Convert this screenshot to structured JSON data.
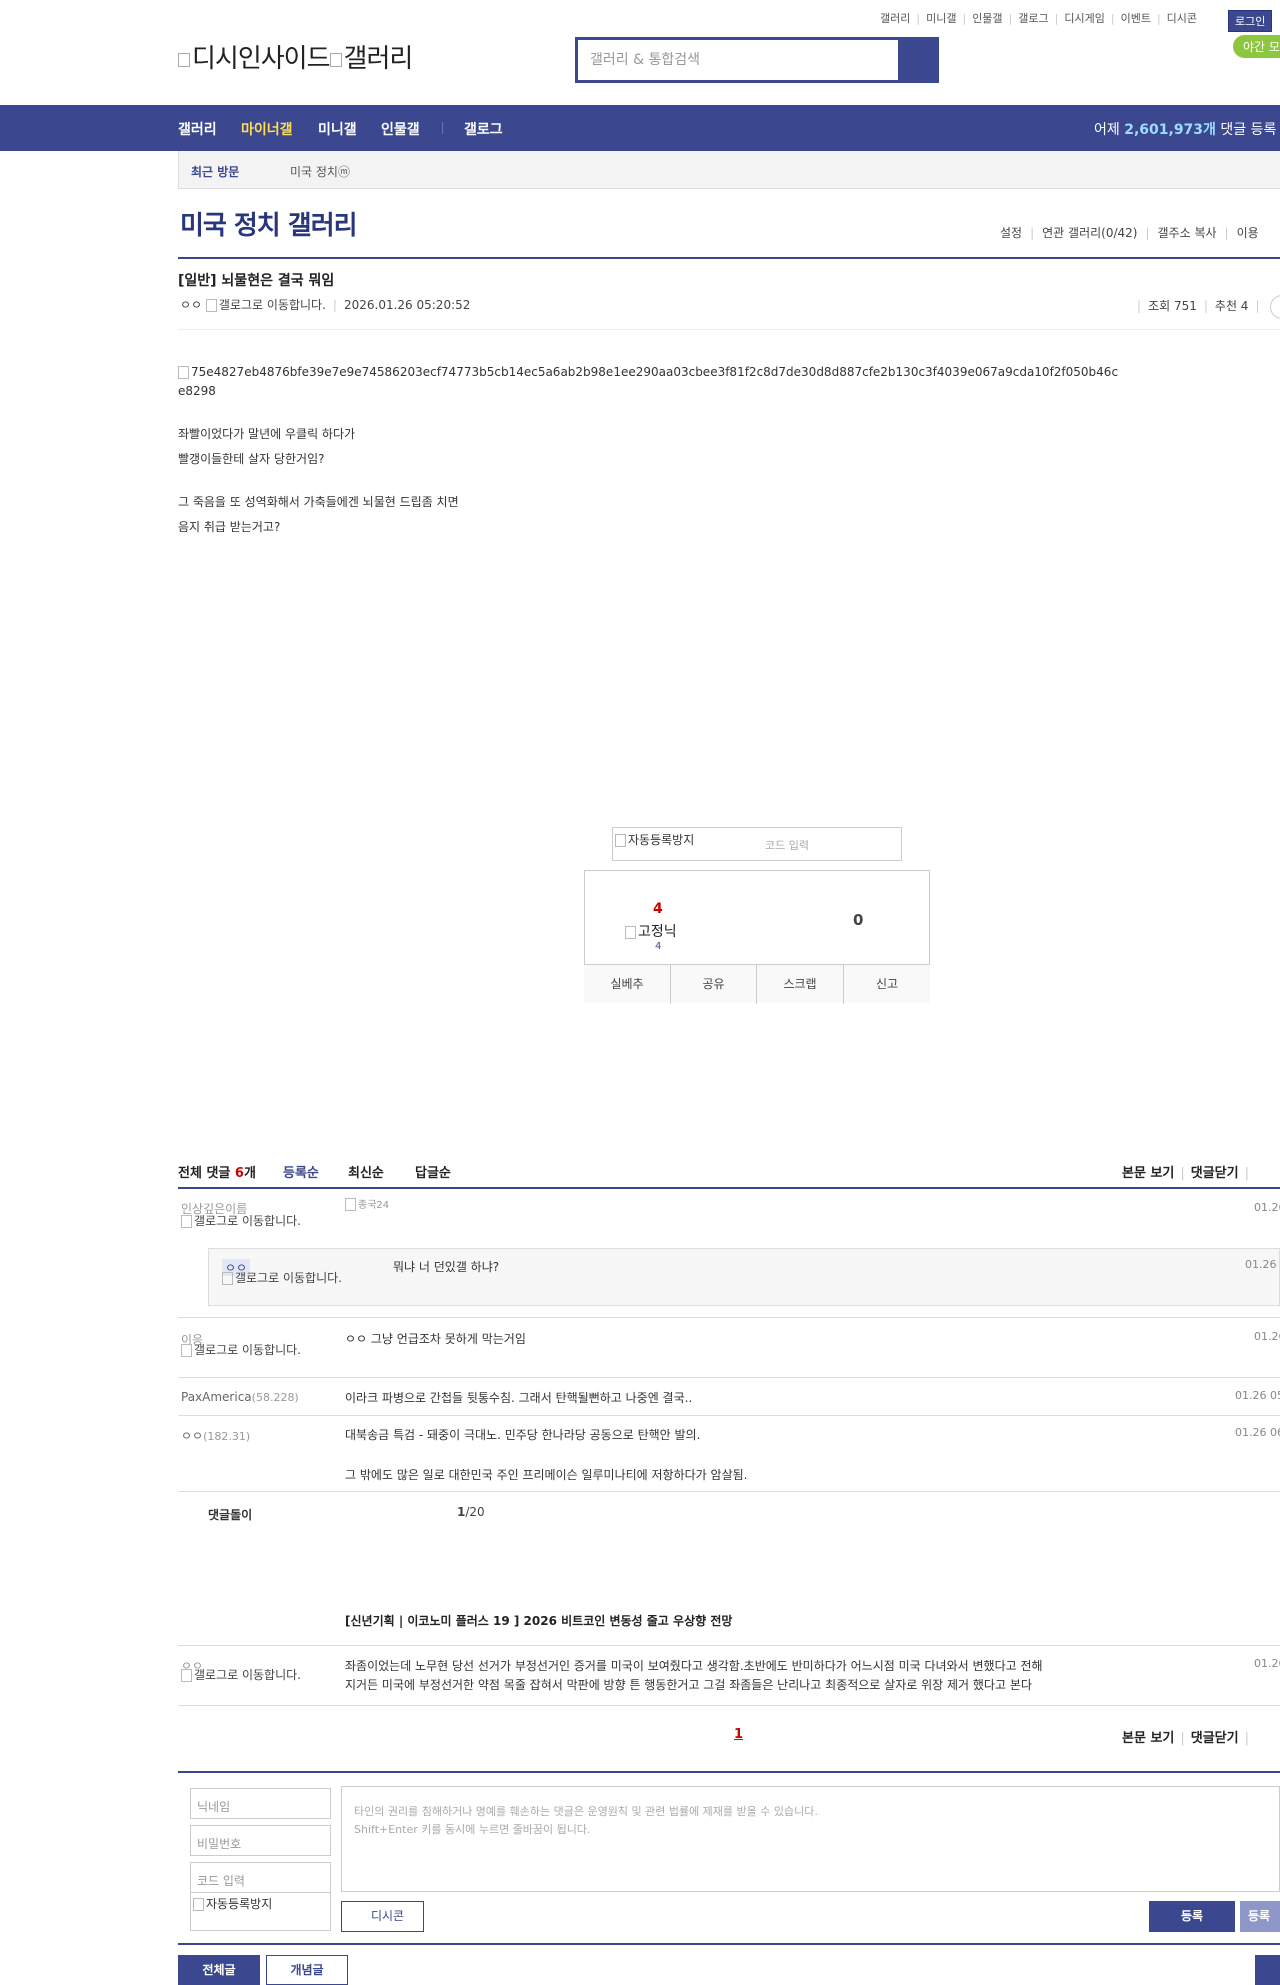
{
  "top_nav": {
    "links": [
      "갤러리",
      "미니갤",
      "인물갤",
      "갤로그",
      "디시게임",
      "이벤트",
      "디시콘"
    ],
    "login": "로그인",
    "night_mode": "야간 모"
  },
  "logo": {
    "alt1": "디시인사이드",
    "alt2": "갤러리"
  },
  "search": {
    "placeholder": "갤러리 & 통합검색"
  },
  "main_nav": {
    "items": [
      "갤러리",
      "마이너갤",
      "미니갤",
      "인물갤",
      "갤로그"
    ],
    "yesterday_prefix": "어제",
    "yesterday_count": "2,601,973개",
    "yesterday_suffix": "댓글 등록"
  },
  "recent": {
    "label": "최근 방문",
    "gallery": "미국 정치ⓜ"
  },
  "gallery": {
    "title": "미국 정치 갤러리",
    "tools": [
      "설정",
      "연관 갤러리(0/42)",
      "갤주소 복사",
      "이용"
    ]
  },
  "post": {
    "title": "[일반] 뇌물현은 결국 뭐임",
    "author": "ㅇㅇ",
    "gallog_alt": "갤로그로 이동합니다.",
    "date": "2026.01.26 05:20:52",
    "views": "조회 751",
    "recommends": "추천 4",
    "image_alt_1": "75e4827eb4876bfe39e7e9e74586203ecf74773b5cb14ec5a6ab2b98e1ee290aa03cbee3f81f2c8d7de30d8d887cfe2b130c3f4039e067a9cda10f2f050b46c",
    "image_alt_2": "e8298",
    "lines": [
      "좌빨이었다가 말년에 우클릭 하다가",
      "빨갱이들한테 살자 당한거임?",
      "그 죽음을 또 성역화해서 가축들에겐 뇌물현 드립좀 치면",
      "음지 취급 받는거고?"
    ]
  },
  "captcha": {
    "img_alt": "자동등록방지",
    "placeholder": "코드 입력"
  },
  "vote": {
    "up": "4",
    "fixed_nick": "고정닉",
    "fixed_count": "4",
    "down": "0",
    "buttons": [
      "실베추",
      "공유",
      "스크랩",
      "신고"
    ]
  },
  "comments_header": {
    "total_label": "전체 댓글",
    "total_count": "6",
    "total_unit": "개",
    "sort": [
      "등록순",
      "최신순",
      "답글순"
    ],
    "tools": [
      "본문 보기",
      "댓글닫기"
    ]
  },
  "comments": [
    {
      "nick": "인상깊은이름",
      "gallog": "갤로그로 이동합니다.",
      "text": "",
      "dccon_alt": "종국24",
      "time": "01.26"
    },
    {
      "nick": "ㅇㅇ",
      "gallog": "갤로그로 이동합니다.",
      "text": "뭐냐 너 던있갤 하냐?",
      "time": "01.26 0"
    },
    {
      "nick": "이응",
      "gallog": "갤로그로 이동합니다.",
      "text": "ㅇㅇ 그냥 언급조차 못하게 막는거임",
      "time": "01.26"
    },
    {
      "nick": "PaxAmerica",
      "ip": "(58.228)",
      "text": "이라크 파병으로 간첩들 뒷통수침. 그래서 탄핵될뻔하고 나중엔 결국..",
      "time": "01.26 05"
    },
    {
      "nick": "ㅇㅇ",
      "ip": "(182.31)",
      "text": "대북송금 특검 - 돼중이 극대노. 민주당 한나라당 공동으로 탄핵안 발의.",
      "text2": "그 밖에도 많은 일로 대한민국 주인 프리메이슨 일루미나티에 저항하다가 암살됨.",
      "time": "01.26 06"
    }
  ],
  "cleanbot": {
    "label": "댓글돌이",
    "page": "1",
    "total": "/20"
  },
  "ad": {
    "title": "[신년기획 | 이코노미 플러스 19 ] 2026 비트코인 변동성 줄고 우상향 전망",
    "nick": "ㅇㅇ",
    "gallog": "갤로그로 이동합니다.",
    "line1": "좌좀이었는데 노무현 당선 선거가 부정선거인 증거를 미국이 보여줬다고 생각함.초반에도 반미하다가 어느시점 미국 다녀와서 변했다고 전해",
    "line2": "지거든 미국에 부정선거한 약점 목줄 잡혀서 막판에 방향 튼 행동한거고 그걸 좌좀들은 난리나고 최종적으로 살자로 위장 제거 했다고 본다",
    "time": "01.26"
  },
  "pager": {
    "current": "1"
  },
  "form": {
    "nickname": "닉네임",
    "password": "비밀번호",
    "code": "코드 입력",
    "captcha_alt": "자동등록방지",
    "textarea_line1": "타인의 권리를 침해하거나 명예를 훼손하는 댓글은 운영원칙 및 관련 법률에 제재를 받을 수 있습니다.",
    "textarea_line2": "Shift+Enter 키를 동시에 누르면 줄바꿈이 됩니다.",
    "dccon": "디시콘",
    "submit": "등록",
    "submit2": "등록"
  },
  "bottom": {
    "all": "전체글",
    "popular": "개념글"
  },
  "colors": {
    "brand": "#3b4890",
    "minor": "#ffdd55",
    "count": "#c00000"
  }
}
